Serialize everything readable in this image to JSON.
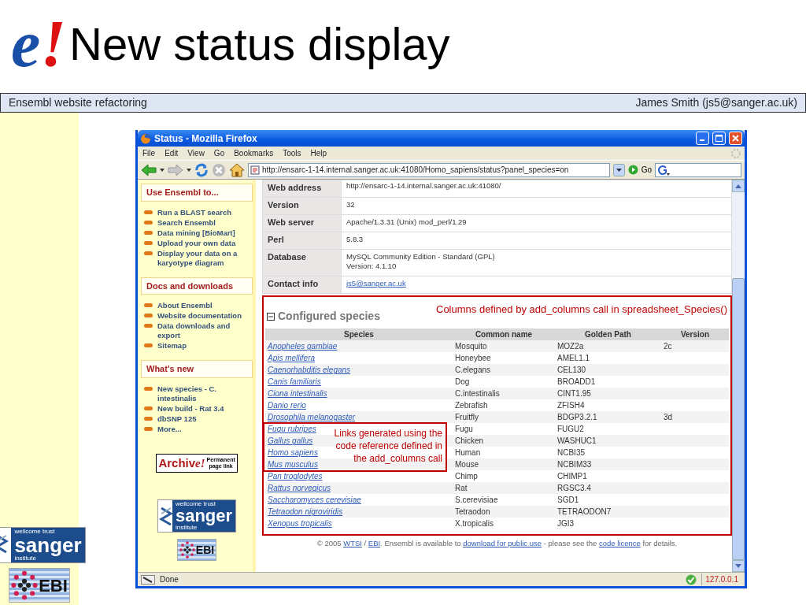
{
  "slide": {
    "logo": {
      "letter": "e",
      "mark": "!"
    },
    "title": "New status display",
    "header_left": "Ensembl website refactoring",
    "header_right": "James Smith (js5@sanger.ac.uk)",
    "side_logos": {
      "sanger": {
        "top": "wellcome trust",
        "main": "sanger",
        "bottom": "institute"
      },
      "ebi": "EBI"
    }
  },
  "window": {
    "title": "Status - Mozilla Firefox"
  },
  "menu": [
    "File",
    "Edit",
    "View",
    "Go",
    "Bookmarks",
    "Tools",
    "Help"
  ],
  "address_bar": {
    "value": "http://ensarc-1-14.internal.sanger.ac.uk:41080/Homo_sapiens/status?panel_species=on"
  },
  "go_button": "Go",
  "sidebar": {
    "sections": [
      {
        "heading": "Use Ensembl to...",
        "items": [
          "Run a BLAST search",
          "Search Ensembl",
          "Data mining [BioMart]",
          "Upload your own data",
          "Display your data on a karyotype diagram"
        ]
      },
      {
        "heading": "Docs and downloads",
        "items": [
          "About Ensembl",
          "Website documentation",
          "Data downloads and export",
          "Sitemap"
        ]
      },
      {
        "heading": "What's new",
        "items": [
          "New species - C. intestinalis",
          "New build - Rat 3.4",
          "dbSNP 125",
          "More..."
        ]
      }
    ],
    "archive": {
      "word": "Archiv",
      "mark": "e!",
      "caption": "Permanent page link"
    },
    "sanger": {
      "top": "wellcome trust",
      "main": "sanger",
      "bottom": "institute"
    },
    "ebi": "EBI"
  },
  "info_table": {
    "rows": [
      {
        "label": "Web address",
        "kind": "text",
        "lines": [
          "http://ensarc-1-14.internal.sanger.ac.uk:41080/"
        ]
      },
      {
        "label": "Version",
        "kind": "text",
        "lines": [
          "32"
        ]
      },
      {
        "label": "Web server",
        "kind": "text",
        "lines": [
          "Apache/1.3.31 (Unix) mod_perl/1.29"
        ]
      },
      {
        "label": "Perl",
        "kind": "text",
        "lines": [
          "5.8.3"
        ]
      },
      {
        "label": "Database",
        "kind": "text",
        "lines": [
          "MySQL Community Edition - Standard (GPL)",
          "Version: 4.1.10"
        ]
      },
      {
        "label": "Contact info",
        "kind": "link",
        "lines": [
          "js5@sanger.ac.uk"
        ]
      }
    ]
  },
  "species_panel": {
    "title": "Configured species",
    "expanded": true,
    "columns": [
      "Species",
      "Common name",
      "Golden Path",
      "Version"
    ],
    "rows": [
      {
        "species": "Anopheles gambiae",
        "common": "Mosquito",
        "golden_path": "MOZ2a",
        "version": "2c"
      },
      {
        "species": "Apis mellifera",
        "common": "Honeybee",
        "golden_path": "AMEL1.1"
      },
      {
        "species": "Caenorhabditis elegans",
        "common": "C.elegans",
        "golden_path": "CEL130"
      },
      {
        "species": "Canis familiaris",
        "common": "Dog",
        "golden_path": "BROADD1"
      },
      {
        "species": "Ciona intestinalis",
        "common": "C.intestinalis",
        "golden_path": "CINT1.95"
      },
      {
        "species": "Danio rerio",
        "common": "Zebrafish",
        "golden_path": "ZFISH4"
      },
      {
        "species": "Drosophila melanogaster",
        "common": "Fruitfly",
        "golden_path": "BDGP3.2.1",
        "version": "3d"
      },
      {
        "species": "Fugu rubripes",
        "common": "Fugu",
        "golden_path": "FUGU2"
      },
      {
        "species": "Gallus gallus",
        "common": "Chicken",
        "golden_path": "WASHUC1"
      },
      {
        "species": "Homo sapiens",
        "common": "Human",
        "golden_path": "NCBI35"
      },
      {
        "species": "Mus musculus",
        "common": "Mouse",
        "golden_path": "NCBIM33"
      },
      {
        "species": "Pan troglodytes",
        "common": "Chimp",
        "golden_path": "CHIMP1"
      },
      {
        "species": "Rattus norvegicus",
        "common": "Rat",
        "golden_path": "RGSC3.4"
      },
      {
        "species": "Saccharomyces cerevisiae",
        "common": "S.cerevisiae",
        "golden_path": "SGD1"
      },
      {
        "species": "Tetraodon nigroviridis",
        "common": "Tetraodon",
        "golden_path": "TETRAODON7"
      },
      {
        "species": "Xenopus tropicalis",
        "common": "X.tropicalis",
        "golden_path": "JGI3"
      }
    ]
  },
  "annotations": [
    {
      "text": "Columns defined by add_columns call in spreadsheet_Species()"
    },
    {
      "text": "Links generated using the code reference defined in the add_columns call"
    }
  ],
  "footer": {
    "parts": [
      {
        "text": "© 2005 "
      },
      {
        "link": "WTSI"
      },
      {
        "text": " / "
      },
      {
        "link": "EBI"
      },
      {
        "text": ". Ensembl is available to "
      },
      {
        "link": "download for public use"
      },
      {
        "text": " - please see the "
      },
      {
        "link": "code licence"
      },
      {
        "text": " for details."
      }
    ]
  },
  "status_bar": {
    "text": "Done",
    "host": "127.0.0.1"
  }
}
